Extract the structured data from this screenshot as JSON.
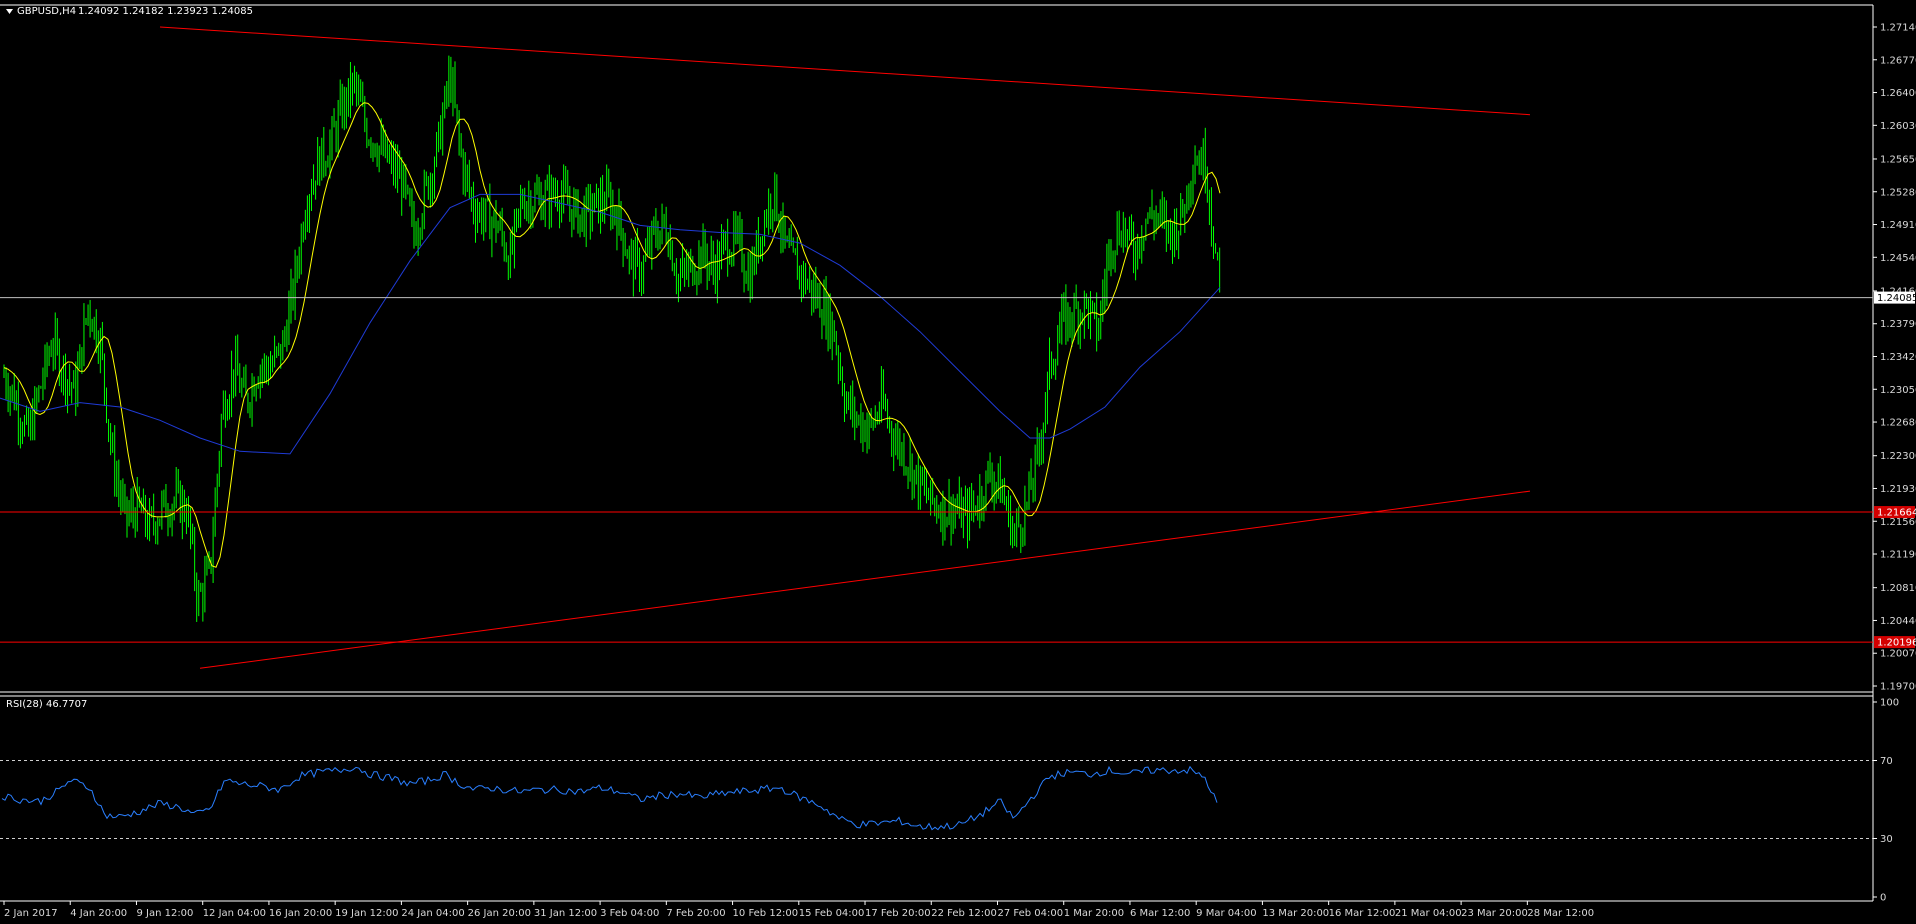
{
  "header": {
    "symbol": "GBPUSD,H4",
    "ohlc": "1.24092 1.24182 1.23923 1.24085"
  },
  "rsi_header": "RSI(28) 46.7707",
  "colors": {
    "background": "#000000",
    "candles": "#00ff00",
    "ma_fast": "#ffff00",
    "ma_slow": "#1f3bd6",
    "trendlines": "#ff0000",
    "current_price_line": "#c0c0c0",
    "rsi_line": "#2a7fff",
    "label_bg_red": "#d40000"
  },
  "chart_data": [
    {
      "type": "line",
      "name": "main",
      "title": "",
      "y_ticks": [
        "1.27140",
        "1.26770",
        "1.26400",
        "1.26030",
        "1.25650",
        "1.25280",
        "1.24910",
        "1.24540",
        "1.24160",
        "1.23790",
        "1.23420",
        "1.23050",
        "1.22680",
        "1.22300",
        "1.21930",
        "1.21560",
        "1.21190",
        "1.20810",
        "1.20440",
        "1.20070",
        "1.19700"
      ],
      "ylim": [
        1.197,
        1.2714
      ],
      "x_ticks": [
        "2 Jan 2017",
        "4 Jan 20:00",
        "9 Jan 12:00",
        "12 Jan 04:00",
        "16 Jan 20:00",
        "19 Jan 12:00",
        "24 Jan 04:00",
        "26 Jan 20:00",
        "31 Jan 12:00",
        "3 Feb 04:00",
        "7 Feb 20:00",
        "10 Feb 12:00",
        "15 Feb 04:00",
        "17 Feb 20:00",
        "22 Feb 12:00",
        "27 Feb 04:00",
        "1 Mar 20:00",
        "6 Mar 12:00",
        "9 Mar 04:00",
        "13 Mar 20:00",
        "16 Mar 12:00",
        "21 Mar 04:00",
        "23 Mar 20:00",
        "28 Mar 12:00"
      ],
      "price_path": [
        [
          0,
          1.233
        ],
        [
          15,
          1.2295
        ],
        [
          28,
          1.225
        ],
        [
          40,
          1.2305
        ],
        [
          52,
          1.236
        ],
        [
          62,
          1.233
        ],
        [
          75,
          1.23
        ],
        [
          88,
          1.24
        ],
        [
          100,
          1.236
        ],
        [
          112,
          1.223
        ],
        [
          125,
          1.216
        ],
        [
          138,
          1.217
        ],
        [
          150,
          1.215
        ],
        [
          162,
          1.217
        ],
        [
          175,
          1.218
        ],
        [
          187,
          1.217
        ],
        [
          198,
          1.2065
        ],
        [
          210,
          1.21
        ],
        [
          222,
          1.228
        ],
        [
          234,
          1.233
        ],
        [
          246,
          1.229
        ],
        [
          258,
          1.233
        ],
        [
          270,
          1.233
        ],
        [
          282,
          1.235
        ],
        [
          294,
          1.242
        ],
        [
          306,
          1.252
        ],
        [
          318,
          1.256
        ],
        [
          330,
          1.258
        ],
        [
          342,
          1.262
        ],
        [
          354,
          1.265
        ],
        [
          366,
          1.26
        ],
        [
          378,
          1.258
        ],
        [
          390,
          1.256
        ],
        [
          402,
          1.254
        ],
        [
          414,
          1.248
        ],
        [
          426,
          1.253
        ],
        [
          438,
          1.258
        ],
        [
          450,
          1.266
        ],
        [
          462,
          1.256
        ],
        [
          474,
          1.251
        ],
        [
          486,
          1.25
        ],
        [
          498,
          1.249
        ],
        [
          510,
          1.245
        ],
        [
          522,
          1.252
        ],
        [
          534,
          1.252
        ],
        [
          546,
          1.252
        ],
        [
          558,
          1.253
        ],
        [
          570,
          1.251
        ],
        [
          582,
          1.25
        ],
        [
          594,
          1.251
        ],
        [
          606,
          1.252
        ],
        [
          618,
          1.25
        ],
        [
          630,
          1.245
        ],
        [
          642,
          1.244
        ],
        [
          654,
          1.248
        ],
        [
          666,
          1.249
        ],
        [
          678,
          1.243
        ],
        [
          690,
          1.244
        ],
        [
          702,
          1.246
        ],
        [
          714,
          1.244
        ],
        [
          726,
          1.247
        ],
        [
          738,
          1.247
        ],
        [
          750,
          1.243
        ],
        [
          762,
          1.249
        ],
        [
          774,
          1.253
        ],
        [
          786,
          1.246
        ],
        [
          798,
          1.244
        ],
        [
          810,
          1.242
        ],
        [
          822,
          1.24
        ],
        [
          834,
          1.237
        ],
        [
          846,
          1.229
        ],
        [
          858,
          1.227
        ],
        [
          870,
          1.226
        ],
        [
          882,
          1.229
        ],
        [
          894,
          1.225
        ],
        [
          906,
          1.223
        ],
        [
          918,
          1.22
        ],
        [
          930,
          1.218
        ],
        [
          942,
          1.217
        ],
        [
          954,
          1.217
        ],
        [
          966,
          1.216
        ],
        [
          978,
          1.218
        ],
        [
          990,
          1.221
        ],
        [
          1002,
          1.219
        ],
        [
          1014,
          1.214
        ],
        [
          1026,
          1.217
        ],
        [
          1038,
          1.223
        ],
        [
          1050,
          1.233
        ],
        [
          1062,
          1.238
        ],
        [
          1074,
          1.239
        ],
        [
          1086,
          1.24
        ],
        [
          1098,
          1.237
        ],
        [
          1110,
          1.247
        ],
        [
          1122,
          1.249
        ],
        [
          1134,
          1.246
        ],
        [
          1146,
          1.25
        ],
        [
          1158,
          1.25
        ],
        [
          1170,
          1.248
        ],
        [
          1182,
          1.25
        ],
        [
          1194,
          1.257
        ],
        [
          1206,
          1.256
        ],
        [
          1216,
          1.245
        ],
        [
          1220,
          1.241
        ]
      ],
      "ma_slow_path": [
        [
          0,
          1.2295
        ],
        [
          40,
          1.228
        ],
        [
          80,
          1.229
        ],
        [
          120,
          1.2285
        ],
        [
          160,
          1.227
        ],
        [
          200,
          1.225
        ],
        [
          240,
          1.2235
        ],
        [
          290,
          1.2232
        ],
        [
          330,
          1.23
        ],
        [
          370,
          1.238
        ],
        [
          410,
          1.245
        ],
        [
          450,
          1.251
        ],
        [
          480,
          1.2525
        ],
        [
          520,
          1.2525
        ],
        [
          560,
          1.2515
        ],
        [
          600,
          1.2505
        ],
        [
          640,
          1.249
        ],
        [
          680,
          1.2485
        ],
        [
          720,
          1.2482
        ],
        [
          760,
          1.248
        ],
        [
          800,
          1.247
        ],
        [
          840,
          1.2445
        ],
        [
          880,
          1.241
        ],
        [
          920,
          1.237
        ],
        [
          960,
          1.2325
        ],
        [
          1000,
          1.228
        ],
        [
          1030,
          1.225
        ],
        [
          1050,
          1.225
        ],
        [
          1070,
          1.226
        ],
        [
          1105,
          1.2285
        ],
        [
          1140,
          1.233
        ],
        [
          1180,
          1.237
        ],
        [
          1220,
          1.242
        ]
      ],
      "horizontal_levels": [
        {
          "price": 1.24085,
          "label": "1.24085",
          "kind": "current"
        },
        {
          "price": 1.21664,
          "label": "1.21664",
          "kind": "support"
        },
        {
          "price": 1.20196,
          "label": "1.20196",
          "kind": "support"
        }
      ],
      "trendlines": [
        {
          "from": [
            160,
            1.2714
          ],
          "to": [
            1530,
            1.2615
          ]
        },
        {
          "from": [
            200,
            1.199
          ],
          "to": [
            1530,
            1.219
          ]
        }
      ]
    },
    {
      "type": "line",
      "name": "rsi",
      "title": "RSI(28) 46.7707",
      "y_ticks": [
        "100",
        "70",
        "30",
        "0"
      ],
      "ylim": [
        0,
        100
      ],
      "levels": [
        70,
        30
      ],
      "values_path": [
        [
          0,
          52
        ],
        [
          20,
          50
        ],
        [
          40,
          49
        ],
        [
          60,
          55
        ],
        [
          70,
          60
        ],
        [
          90,
          56
        ],
        [
          105,
          42
        ],
        [
          120,
          41
        ],
        [
          140,
          44
        ],
        [
          160,
          48
        ],
        [
          180,
          46
        ],
        [
          195,
          42
        ],
        [
          210,
          45
        ],
        [
          225,
          60
        ],
        [
          240,
          58
        ],
        [
          260,
          57
        ],
        [
          280,
          55
        ],
        [
          300,
          62
        ],
        [
          320,
          64
        ],
        [
          340,
          65
        ],
        [
          355,
          67
        ],
        [
          370,
          63
        ],
        [
          390,
          61
        ],
        [
          410,
          58
        ],
        [
          430,
          60
        ],
        [
          445,
          63
        ],
        [
          460,
          58
        ],
        [
          475,
          55
        ],
        [
          490,
          56
        ],
        [
          505,
          55
        ],
        [
          520,
          54
        ],
        [
          540,
          55
        ],
        [
          560,
          55
        ],
        [
          580,
          54
        ],
        [
          600,
          56
        ],
        [
          620,
          54
        ],
        [
          640,
          50
        ],
        [
          660,
          52
        ],
        [
          680,
          53
        ],
        [
          700,
          51
        ],
        [
          720,
          53
        ],
        [
          740,
          54
        ],
        [
          760,
          55
        ],
        [
          780,
          56
        ],
        [
          800,
          51
        ],
        [
          820,
          47
        ],
        [
          840,
          40
        ],
        [
          860,
          37
        ],
        [
          880,
          38
        ],
        [
          900,
          39
        ],
        [
          920,
          36
        ],
        [
          940,
          36
        ],
        [
          960,
          37
        ],
        [
          980,
          42
        ],
        [
          1000,
          49
        ],
        [
          1014,
          40
        ],
        [
          1030,
          50
        ],
        [
          1050,
          62
        ],
        [
          1070,
          64
        ],
        [
          1090,
          63
        ],
        [
          1110,
          65
        ],
        [
          1130,
          63
        ],
        [
          1150,
          65
        ],
        [
          1170,
          65
        ],
        [
          1190,
          65
        ],
        [
          1205,
          61
        ],
        [
          1218,
          47
        ]
      ]
    }
  ]
}
